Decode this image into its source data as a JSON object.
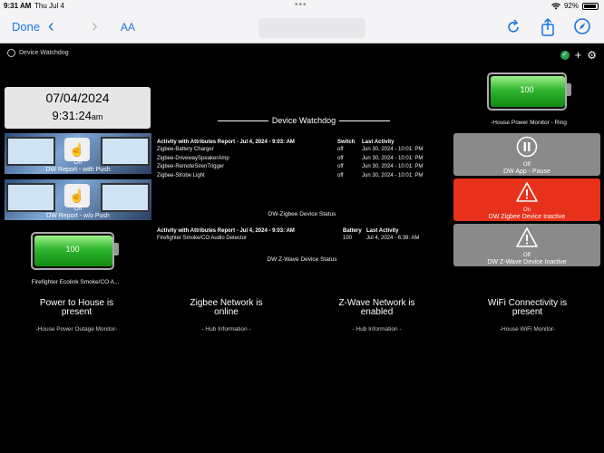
{
  "status_bar": {
    "time": "9:31 AM",
    "date": "Thu Jul 4",
    "battery": "92%",
    "battery_level": 0.92
  },
  "browser": {
    "done_label": "Done",
    "text_size_label": "AA"
  },
  "dashboard": {
    "title": "Device Watchdog"
  },
  "clock": {
    "date": "07/04/2024",
    "time": "9:31:24",
    "ampm": "am"
  },
  "tiles_left": [
    {
      "status": "Off",
      "label": "DW Report - with Push"
    },
    {
      "status": "Off",
      "label": "DW Report - w/o Push"
    }
  ],
  "battery_left": {
    "value": "100",
    "level": 1.0,
    "label": "Firefighter Ecolink Smoke/CO A..."
  },
  "battery_right": {
    "value": "100",
    "level": 1.0,
    "label": "-House Power Monitor - Ring"
  },
  "section_title": "Device Watchdog",
  "zigbee_report": {
    "headers": [
      "Activity with Attributes Report - Jul 4, 2024 - 9:03: AM",
      "Switch",
      "Last Activity"
    ],
    "rows": [
      [
        "Zigbee-Battery Charger",
        "off",
        "Jun 30, 2024 - 10:01: PM"
      ],
      [
        "Zigbee-DrivewaySpeakerAmp",
        "off",
        "Jun 30, 2024 - 10:01: PM"
      ],
      [
        "Zigbee-RemoteSirenTrigger",
        "off",
        "Jun 30, 2024 - 10:01: PM"
      ],
      [
        "Zigbee-Strobe Light",
        "off",
        "Jun 30, 2024 - 10:01: PM"
      ]
    ],
    "caption": "DW-Zigbee Device Status"
  },
  "zwave_report": {
    "headers": [
      "Activity with Attributes Report - Jul 4, 2024 - 9:03: AM",
      "Battery",
      "Last Activity"
    ],
    "rows": [
      [
        "Firefighter Smoke/CO Audio Detector",
        "100",
        "Jul 4, 2024 - 6:39: AM"
      ]
    ],
    "caption": "DW Z-Wave Device Status"
  },
  "tiles_right": [
    {
      "status": "Off",
      "label": "DW App - Pause",
      "color": "#8a8a8a",
      "icon": "pause-icon"
    },
    {
      "status": "On",
      "label": "DW Zigbee Device Inactive",
      "color": "#e8311a",
      "icon": "warning-icon"
    },
    {
      "status": "Off",
      "label": "DW Z-Wave Device Inactive",
      "color": "#8a8a8a",
      "icon": "warning-icon"
    }
  ],
  "bottom_tiles": [
    {
      "line1": "Power to House is",
      "line2": "present",
      "label": "-House Power Outage Monitor-"
    },
    {
      "line1": "Zigbee Network is",
      "line2": "online",
      "label": "- Hub Information -"
    },
    {
      "line1": "Z-Wave Network is",
      "line2": "enabled",
      "label": "- Hub Information -"
    },
    {
      "line1": "WiFi Connectivity is",
      "line2": "present",
      "label": "-House WiFi Monitor-"
    }
  ]
}
